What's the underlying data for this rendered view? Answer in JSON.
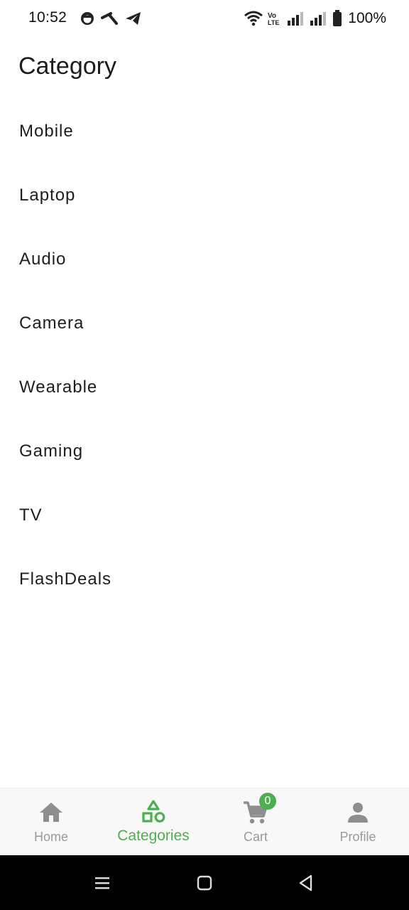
{
  "status_bar": {
    "time": "10:52",
    "battery_text": "100%",
    "left_icons": [
      "notification-app-icon",
      "telenor-icon",
      "telegram-icon"
    ],
    "right_icons": [
      "wifi-icon",
      "volte-icon",
      "signal-icon",
      "signal-icon",
      "battery-icon"
    ]
  },
  "header": {
    "title": "Category"
  },
  "categories": [
    {
      "label": "Mobile"
    },
    {
      "label": "Laptop"
    },
    {
      "label": "Audio"
    },
    {
      "label": "Camera"
    },
    {
      "label": "Wearable"
    },
    {
      "label": "Gaming"
    },
    {
      "label": "TV"
    },
    {
      "label": "FlashDeals"
    }
  ],
  "bottom_nav": {
    "items": [
      {
        "label": "Home",
        "icon": "home-icon"
      },
      {
        "label": "Categories",
        "icon": "categories-icon",
        "active": true
      },
      {
        "label": "Cart",
        "icon": "cart-icon",
        "badge": "0"
      },
      {
        "label": "Profile",
        "icon": "person-icon"
      }
    ]
  },
  "colors": {
    "accent": "#4caf50",
    "inactive": "#9a9a9a",
    "nav_bg": "#f8f8f8"
  },
  "system_nav": {
    "icons": [
      "menu-icon",
      "home-square-icon",
      "back-icon"
    ]
  }
}
